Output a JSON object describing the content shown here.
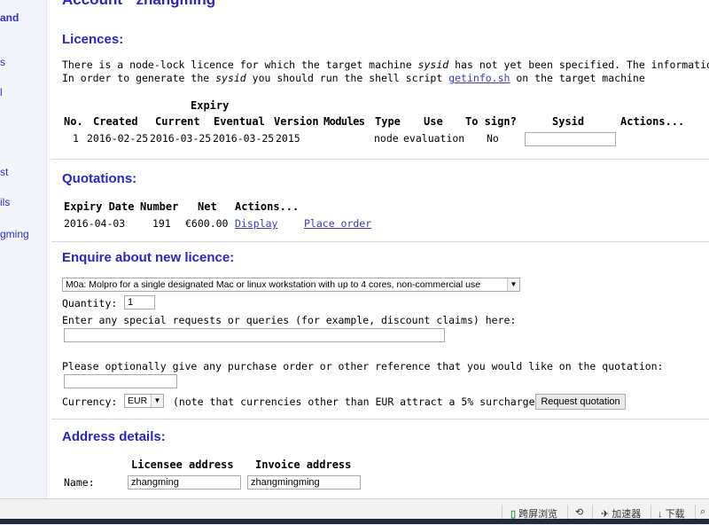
{
  "sidebar": {
    "items": [
      "and",
      "s",
      "l",
      "st",
      "ils",
      "gming"
    ]
  },
  "account": {
    "prefix": "Account",
    "user": "zhangming"
  },
  "licences": {
    "heading": "Licences:",
    "notice_1a": "There is a node-lock licence for which the target machine ",
    "notice_1em": "sysid",
    "notice_1b": " has not yet been specified. The information o",
    "notice_2a": "In order to generate the ",
    "notice_2em": "sysid",
    "notice_2b": " you should run the shell script ",
    "notice_2link": "getinfo.sh",
    "notice_2c": " on the target machine",
    "group_header": "Expiry",
    "columns": [
      "No.",
      "Created",
      "Current",
      "Eventual",
      "Version",
      "Modules",
      "Type",
      "Use",
      "To sign?",
      "Sysid",
      "Actions..."
    ],
    "row": {
      "no": "1",
      "created": "2016-02-25",
      "current": "2016-03-25",
      "eventual": "2016-03-25",
      "version": "2015",
      "type": "node",
      "use": "evaluation",
      "to_sign": "No"
    }
  },
  "quotations": {
    "heading": "Quotations:",
    "columns": [
      "Expiry Date",
      "Number",
      "Net",
      "Actions..."
    ],
    "row": {
      "expiry": "2016-04-03",
      "number": "191",
      "net": "€600.00",
      "display": "Display",
      "place_order": "Place order"
    }
  },
  "enquire": {
    "heading": "Enquire about new licence:",
    "product": "M0a: Molpro for a single designated Mac or linux workstation with up to 4 cores, non-commercial use",
    "quantity_label": "Quantity:",
    "quantity": "1",
    "requests_label": "Enter any special requests or queries (for example, discount claims) here:",
    "po_label": "Please optionally give any purchase order or other reference that you would like on the quotation:",
    "currency_label": "Currency:",
    "currency": "EUR",
    "currency_note": "(note that currencies other than EUR attract a 5% surcharge)",
    "request_button": "Request quotation"
  },
  "address": {
    "heading": "Address details:",
    "licensee_header": "Licensee address",
    "invoice_header": "Invoice address",
    "name_label": "Name:",
    "licensee_name": "zhangming",
    "invoice_name": "zhangmingming"
  },
  "statusbar": {
    "split_view": "跨屏浏览",
    "accelerator": "加速器",
    "download": "下载"
  }
}
